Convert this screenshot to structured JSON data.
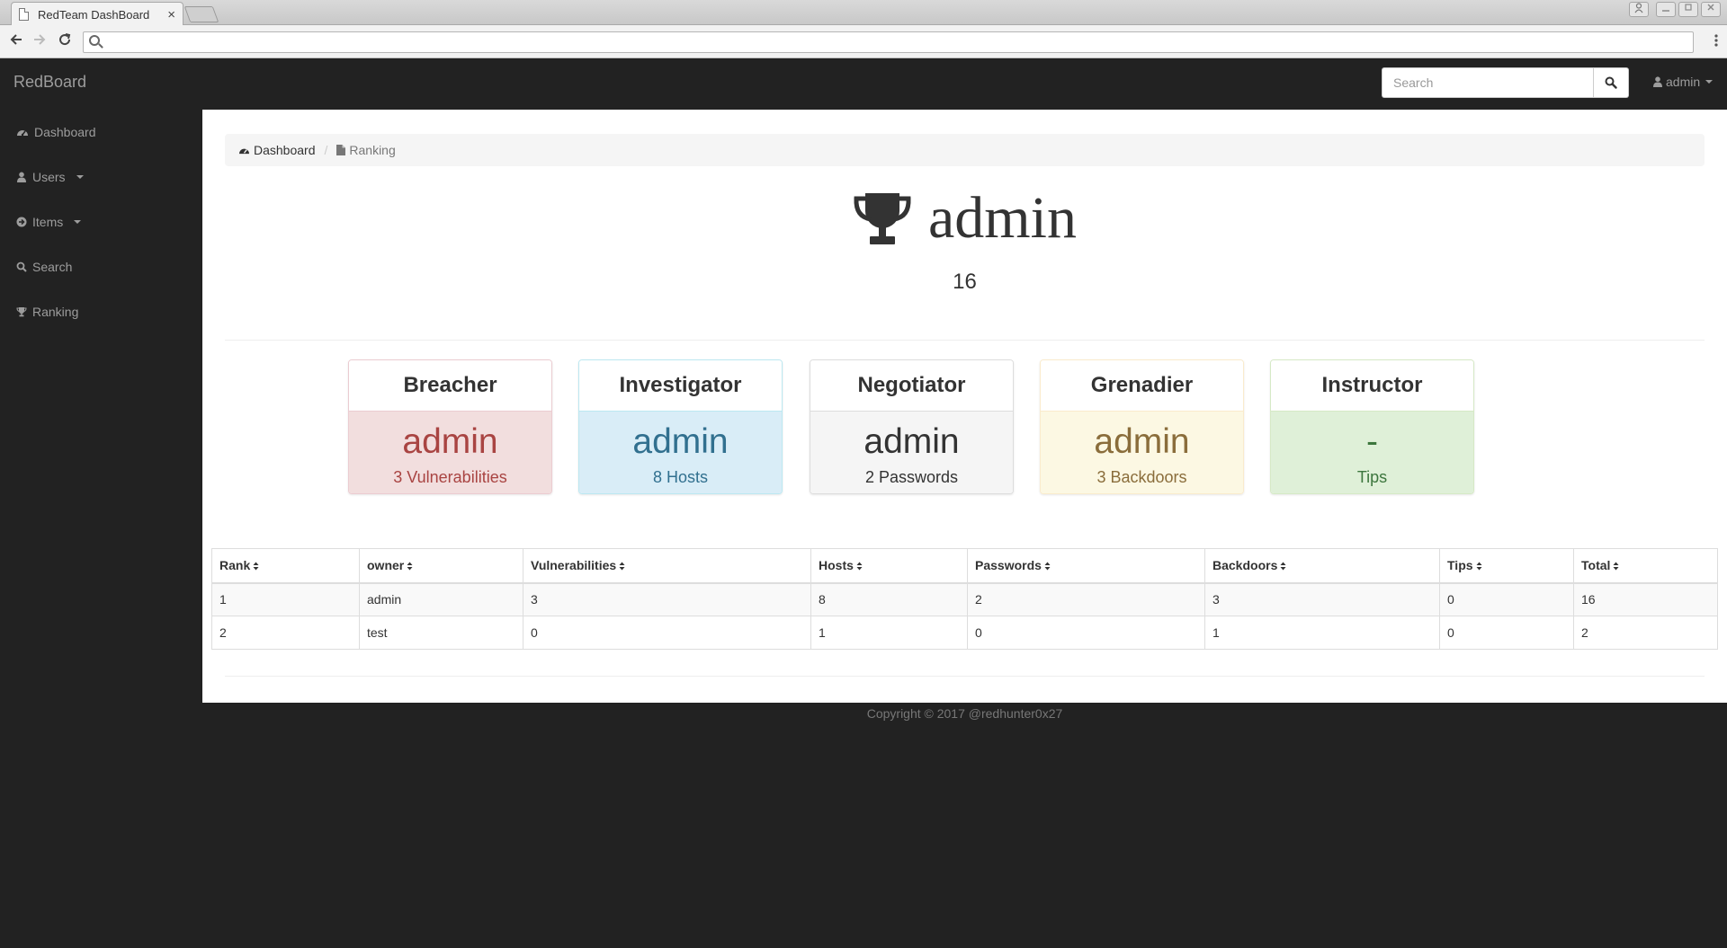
{
  "browser": {
    "tab_title": "RedTeam DashBoard",
    "tab_close": "×",
    "url": ""
  },
  "navbar": {
    "brand": "RedBoard",
    "search_placeholder": "Search",
    "user": "admin"
  },
  "sidebar": {
    "items": [
      {
        "label": "Dashboard",
        "icon": "dashboard-icon",
        "has_caret": false
      },
      {
        "label": "Users",
        "icon": "user-icon",
        "has_caret": true
      },
      {
        "label": "Items",
        "icon": "arrow-circle-icon",
        "has_caret": true
      },
      {
        "label": "Search",
        "icon": "search-icon",
        "has_caret": false
      },
      {
        "label": "Ranking",
        "icon": "trophy-icon",
        "has_caret": false
      }
    ]
  },
  "breadcrumb": {
    "home": "Dashboard",
    "current": "Ranking"
  },
  "hero": {
    "name": "admin",
    "score": "16"
  },
  "cards": [
    {
      "title": "Breacher",
      "name": "admin",
      "sub": "3 Vulnerabilities",
      "color": "#a94442",
      "bg": "#f2dede",
      "border": "#ebccd1"
    },
    {
      "title": "Investigator",
      "name": "admin",
      "sub": "8 Hosts",
      "color": "#31708f",
      "bg": "#d9edf7",
      "border": "#bce8f1"
    },
    {
      "title": "Negotiator",
      "name": "admin",
      "sub": "2 Passwords",
      "color": "#333333",
      "bg": "#f5f5f5",
      "border": "#dddddd"
    },
    {
      "title": "Grenadier",
      "name": "admin",
      "sub": "3 Backdoors",
      "color": "#8a6d3b",
      "bg": "#fcf8e3",
      "border": "#faebcc"
    },
    {
      "title": "Instructor",
      "name": "-",
      "sub": "Tips",
      "color": "#3c763d",
      "bg": "#dff0d8",
      "border": "#d6e9c6"
    }
  ],
  "table": {
    "headers": [
      "Rank",
      "owner",
      "Vulnerabilities",
      "Hosts",
      "Passwords",
      "Backdoors",
      "Tips",
      "Total"
    ],
    "rows": [
      [
        "1",
        "admin",
        "3",
        "8",
        "2",
        "3",
        "0",
        "16"
      ],
      [
        "2",
        "test",
        "0",
        "1",
        "0",
        "1",
        "0",
        "2"
      ]
    ]
  },
  "footer": {
    "text": "Copyright © 2017 @redhunter0x27"
  }
}
